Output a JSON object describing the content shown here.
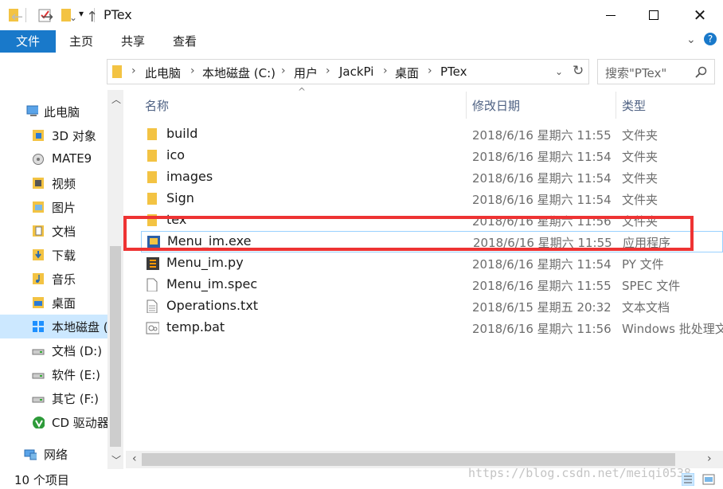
{
  "window": {
    "title": "PTex"
  },
  "ribbon": {
    "tabs": [
      "文件",
      "主页",
      "共享",
      "查看"
    ]
  },
  "address": {
    "crumbs": [
      "此电脑",
      "本地磁盘 (C:)",
      "用户",
      "JackPi",
      "桌面",
      "PTex"
    ]
  },
  "search": {
    "placeholder": "搜索\"PTex\""
  },
  "sidebar": {
    "items": [
      {
        "label": "此电脑",
        "icon": "computer-icon"
      },
      {
        "label": "3D 对象",
        "icon": "3d-objects-icon"
      },
      {
        "label": "MATE9",
        "icon": "phone-icon"
      },
      {
        "label": "视频",
        "icon": "video-folder-icon"
      },
      {
        "label": "图片",
        "icon": "pictures-folder-icon"
      },
      {
        "label": "文档",
        "icon": "documents-folder-icon"
      },
      {
        "label": "下载",
        "icon": "downloads-folder-icon"
      },
      {
        "label": "音乐",
        "icon": "music-folder-icon"
      },
      {
        "label": "桌面",
        "icon": "desktop-folder-icon"
      },
      {
        "label": "本地磁盘 (",
        "icon": "local-disk-icon"
      },
      {
        "label": "文档 (D:)",
        "icon": "drive-icon"
      },
      {
        "label": "软件 (E:)",
        "icon": "drive-icon"
      },
      {
        "label": "其它 (F:)",
        "icon": "drive-icon"
      },
      {
        "label": "CD 驱动器",
        "icon": "cd-drive-icon"
      },
      {
        "label": "网络",
        "icon": "network-icon"
      }
    ]
  },
  "columns": {
    "name": "名称",
    "date": "修改日期",
    "type": "类型"
  },
  "files": [
    {
      "name": "build",
      "date": "2018/6/16 星期六 11:55",
      "type": "文件夹",
      "icon": "folder-icon"
    },
    {
      "name": "ico",
      "date": "2018/6/16 星期六 11:54",
      "type": "文件夹",
      "icon": "folder-icon"
    },
    {
      "name": "images",
      "date": "2018/6/16 星期六 11:54",
      "type": "文件夹",
      "icon": "folder-icon"
    },
    {
      "name": "Sign",
      "date": "2018/6/16 星期六 11:54",
      "type": "文件夹",
      "icon": "folder-icon"
    },
    {
      "name": "tex",
      "date": "2018/6/16 星期六 11:56",
      "type": "文件夹",
      "icon": "folder-icon"
    },
    {
      "name": "Menu_im.exe",
      "date": "2018/6/16 星期六 11:55",
      "type": "应用程序",
      "icon": "exe-icon"
    },
    {
      "name": "Menu_im.py",
      "date": "2018/6/16 星期六 11:54",
      "type": "PY 文件",
      "icon": "python-file-icon"
    },
    {
      "name": "Menu_im.spec",
      "date": "2018/6/16 星期六 11:55",
      "type": "SPEC 文件",
      "icon": "blank-file-icon"
    },
    {
      "name": "Operations.txt",
      "date": "2018/6/15 星期五 20:32",
      "type": "文本文档",
      "icon": "text-file-icon"
    },
    {
      "name": "temp.bat",
      "date": "2018/6/16 星期六 11:56",
      "type": "Windows 批处理文",
      "icon": "batch-file-icon"
    }
  ],
  "status": {
    "item_count": "10 个项目"
  },
  "watermark": "https://blog.csdn.net/meiqi0538",
  "colors": {
    "accent": "#1979ca",
    "highlight_box": "#ee3333",
    "folder": "#f3c343"
  }
}
